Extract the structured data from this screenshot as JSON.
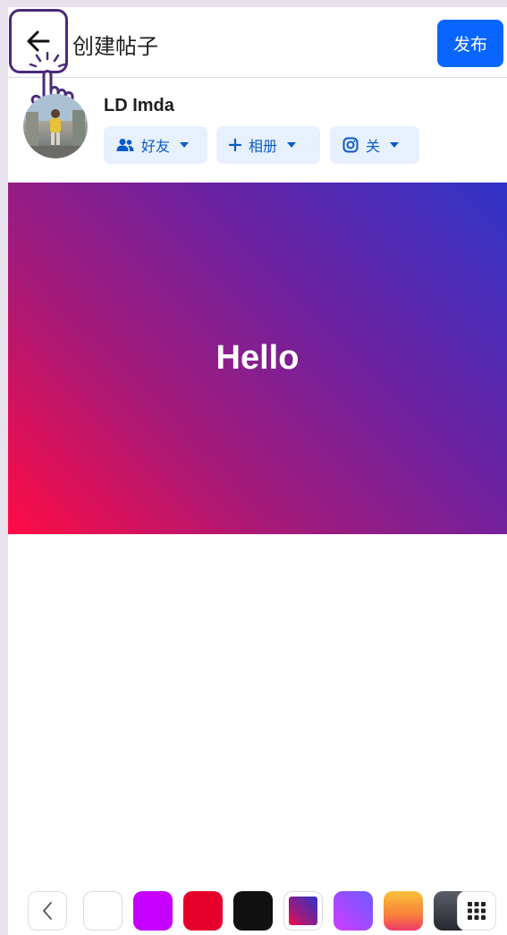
{
  "header": {
    "title": "创建帖子",
    "publish_label": "发布",
    "back_icon": "arrow-left-icon"
  },
  "user": {
    "name": "LD Imda",
    "audience_label": "好友",
    "album_label": "相册",
    "instagram_label": "关"
  },
  "post": {
    "text": "Hello",
    "background_gradient": [
      "#2f33c8",
      "#6e22a0",
      "#a61a78",
      "#ff0b44"
    ]
  },
  "palette": {
    "swatches": [
      {
        "name": "white",
        "color": "#ffffff"
      },
      {
        "name": "purple",
        "color": "#c600ff"
      },
      {
        "name": "red",
        "color": "#e4002b"
      },
      {
        "name": "black",
        "color": "#111111"
      },
      {
        "name": "blue-magenta-gradient",
        "color": "#6b21a8"
      },
      {
        "name": "violet-gradient",
        "color": "#9b3cf0"
      },
      {
        "name": "orange-pink-gradient",
        "color": "#f7a23a"
      },
      {
        "name": "dark-gray-gradient",
        "color": "#3c3f48"
      }
    ]
  }
}
